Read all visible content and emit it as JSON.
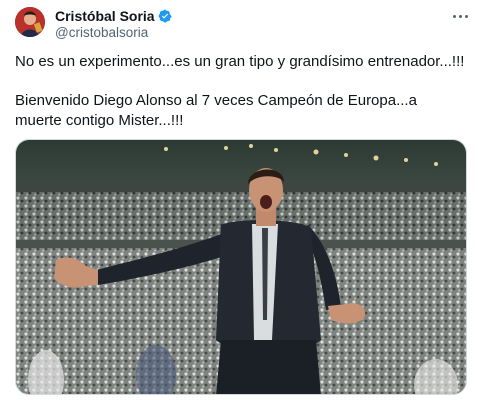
{
  "author": {
    "display_name": "Cristóbal Soria",
    "handle": "@cristobalsoria",
    "verified": true
  },
  "tweet": {
    "line1": "No es un experimento...es un gran tipo y grandísimo entrenador...!!!",
    "line2": "Bienvenido Diego Alonso al 7 veces Campeón de Europa...a muerte contigo Mister...!!!"
  },
  "media": {
    "description_icon": "photo"
  },
  "colors": {
    "verified_blue": "#1d9bf0",
    "text_primary": "#0f1419",
    "text_secondary": "#536471"
  }
}
